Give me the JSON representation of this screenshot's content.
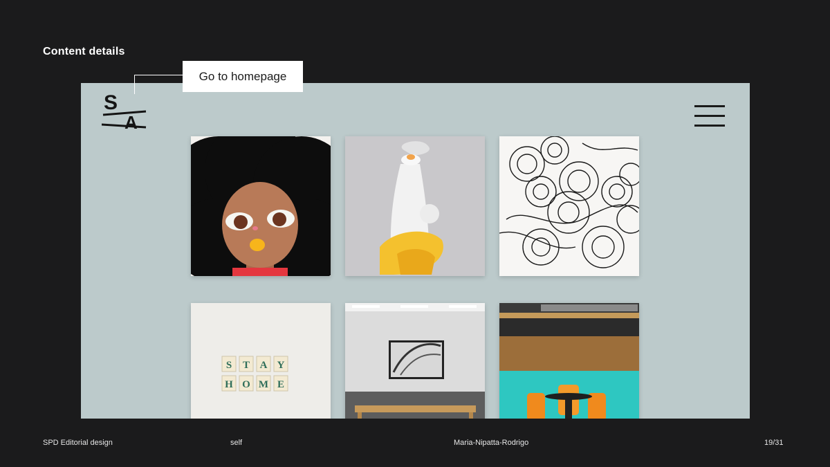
{
  "slide": {
    "title": "Content details"
  },
  "callout": {
    "label": "Go to homepage"
  },
  "mockup": {
    "logo_letters": [
      "S",
      "A"
    ],
    "menu_icon": "hamburger-menu-icon",
    "background": "#bccacb",
    "grid": [
      {
        "name": "illustrated-girl-portrait"
      },
      {
        "name": "white-sculpture-vase"
      },
      {
        "name": "ink-circle-drawing"
      },
      {
        "name": "stay-home-letter-tiles",
        "tiles_row1": [
          "S",
          "T",
          "A",
          "Y"
        ],
        "tiles_row2": [
          "H",
          "O",
          "M",
          "E"
        ]
      },
      {
        "name": "gallery-room-artwork"
      },
      {
        "name": "orange-chairs-teal-wall"
      }
    ]
  },
  "footer": {
    "project": "SPD Editorial design",
    "type": "self",
    "author": "Maria-Nipatta-Rodrigo",
    "page": "19/31"
  }
}
